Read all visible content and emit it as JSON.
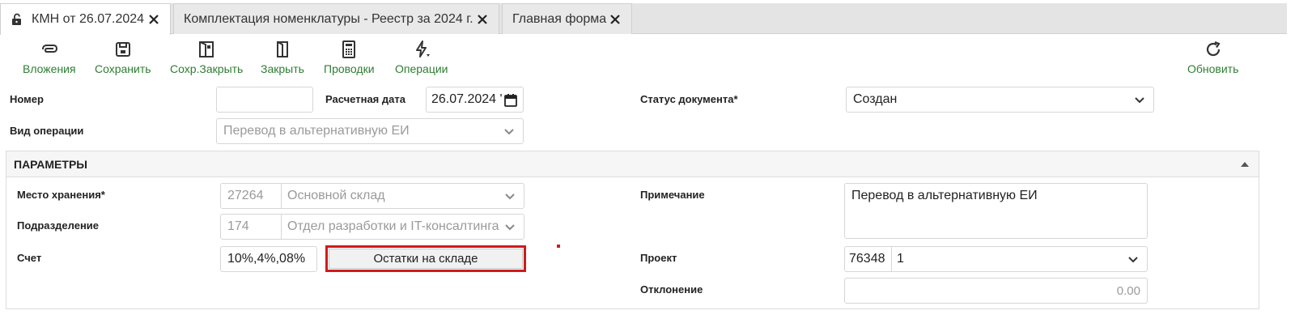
{
  "tabs": [
    {
      "label": "КМН от 26.07.2024",
      "active": true
    },
    {
      "label": "Комплектация номенклатуры - Реестр за 2024 г.",
      "active": false
    },
    {
      "label": "Главная форма",
      "active": false
    }
  ],
  "toolbar": {
    "attachments": "Вложения",
    "save": "Сохранить",
    "save_close": "Сохр.Закрыть",
    "close": "Закрыть",
    "postings": "Проводки",
    "operations": "Операции",
    "refresh": "Обновить"
  },
  "header": {
    "number_label": "Номер",
    "number_value": "",
    "calc_date_label": "Расчетная дата",
    "calc_date_value": "26.07.2024 '",
    "status_label": "Статус документа*",
    "status_value": "Создан",
    "operation_type_label": "Вид операции",
    "operation_type_value": "Перевод в альтернативную ЕИ"
  },
  "params": {
    "title": "ПАРАМЕТРЫ",
    "storage_label": "Место хранения*",
    "storage_code": "27264",
    "storage_name": "Основной склад",
    "division_label": "Подразделение",
    "division_code": "174",
    "division_name": "Отдел разработки и IT-консалтинга",
    "account_label": "Счет",
    "account_value": "10%,4%,08%",
    "stock_button": "Остатки на складе",
    "note_label": "Примечание",
    "note_value": "Перевод в альтернативную ЕИ",
    "project_label": "Проект",
    "project_code": "76348",
    "project_value": "1",
    "deviation_label": "Отклонение",
    "deviation_value": "0.00"
  },
  "colors": {
    "accent": "#2e7d32",
    "highlight": "#d11a1a"
  }
}
